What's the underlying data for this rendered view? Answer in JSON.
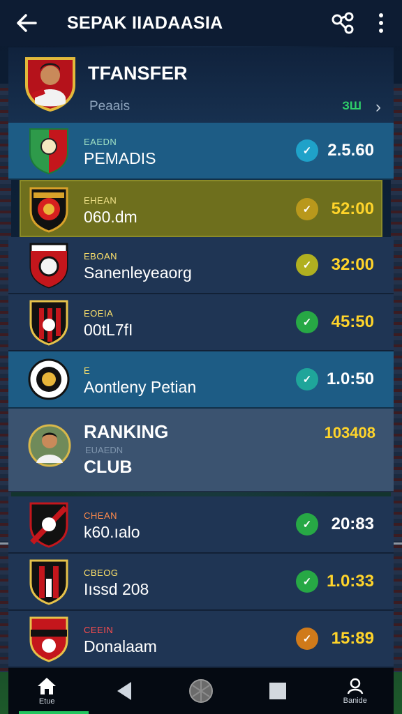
{
  "app": {
    "title": "SEPAK IIADAASIA"
  },
  "icons": {
    "back": "arrow-left-icon",
    "share": "share-icon",
    "more": "more-vertical-icon",
    "chevron": "chevron-right-icon"
  },
  "transfer": {
    "title": "TFANSFER",
    "subtitle": "Peaais",
    "badge": "ЗШ",
    "chevron": "›"
  },
  "rows": [
    {
      "small": "EAEDN",
      "name": "PEMADIS",
      "time": "2.5.60",
      "dot_color": "#1fa2c9",
      "dot_glyph": "✓",
      "bg": "hl-blue"
    },
    {
      "small": "EHEAN",
      "name": "060.dm",
      "time": "52:00",
      "dot_color": "#b9981c",
      "dot_glyph": "✓",
      "bg": "hl-olive"
    },
    {
      "small": "EBOAN",
      "name": "Sanenleyeaorg",
      "time": "32:00",
      "dot_color": "#b0b020",
      "dot_glyph": "✓",
      "bg": ""
    },
    {
      "small": "EOEIA",
      "name": "00tL7fI",
      "time": "45:50",
      "dot_color": "#27a845",
      "dot_glyph": "✓",
      "bg": ""
    },
    {
      "small": "E",
      "name": "Aontleny Petian",
      "time": "1.0:50",
      "dot_color": "#1fa59a",
      "dot_glyph": "✓",
      "bg": "hl-blue"
    }
  ],
  "ranking": {
    "title": "RANKING",
    "faded": "EUAEDN",
    "club": "CLUB",
    "score": "103408"
  },
  "rows2": [
    {
      "small": "CHEAN",
      "name": "k60.ıalo",
      "time": "20:83",
      "dot_color": "#27a845",
      "dot_glyph": "✓"
    },
    {
      "small": "CBEOG",
      "name": "Iıssd 208",
      "time": "1.0:33",
      "dot_color": "#27a845",
      "dot_glyph": "✓"
    },
    {
      "small": "CEEIN",
      "name": "Donalaam",
      "time": "15:89",
      "dot_color": "#d07a1a",
      "dot_glyph": "✓"
    }
  ],
  "bottom_nav": {
    "home_label": "Etue",
    "profile_label": "Banide"
  },
  "colors": {
    "accent_green": "#22c55e",
    "time_yellow": "#ffd42a"
  }
}
